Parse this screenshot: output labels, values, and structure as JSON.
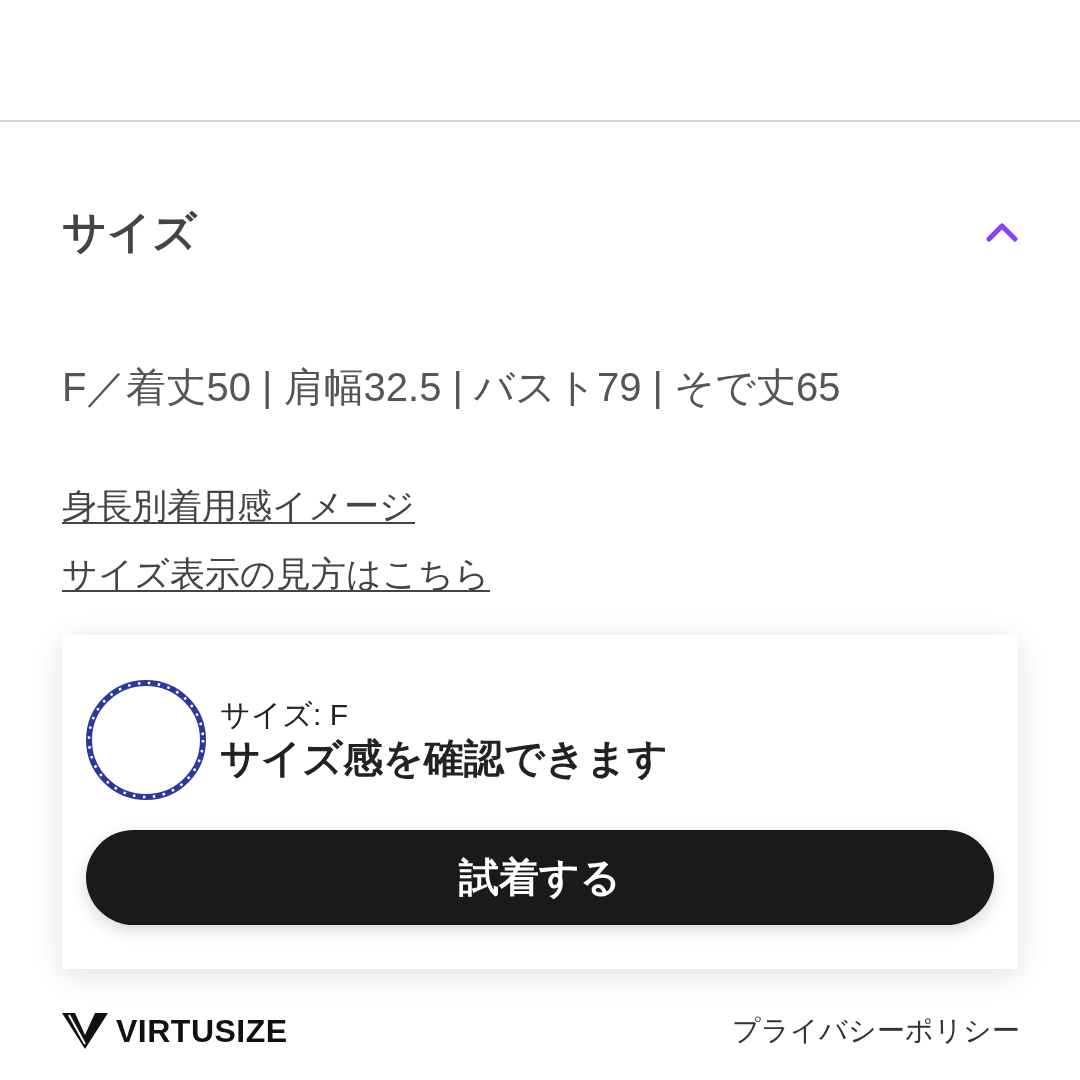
{
  "section": {
    "title": "サイズ",
    "expanded": true
  },
  "size_spec": "F／着丈50 | 肩幅32.5 | バスト79 | そで丈65",
  "links": [
    "身長別着用感イメージ",
    "サイズ表示の見方はこちら"
  ],
  "widget": {
    "size_label": "サイズ: F",
    "message": "サイズ感を確認できます",
    "button": "試着する"
  },
  "footer": {
    "brand": "VIRTUSIZE",
    "privacy_link": "プライバシーポリシー"
  }
}
